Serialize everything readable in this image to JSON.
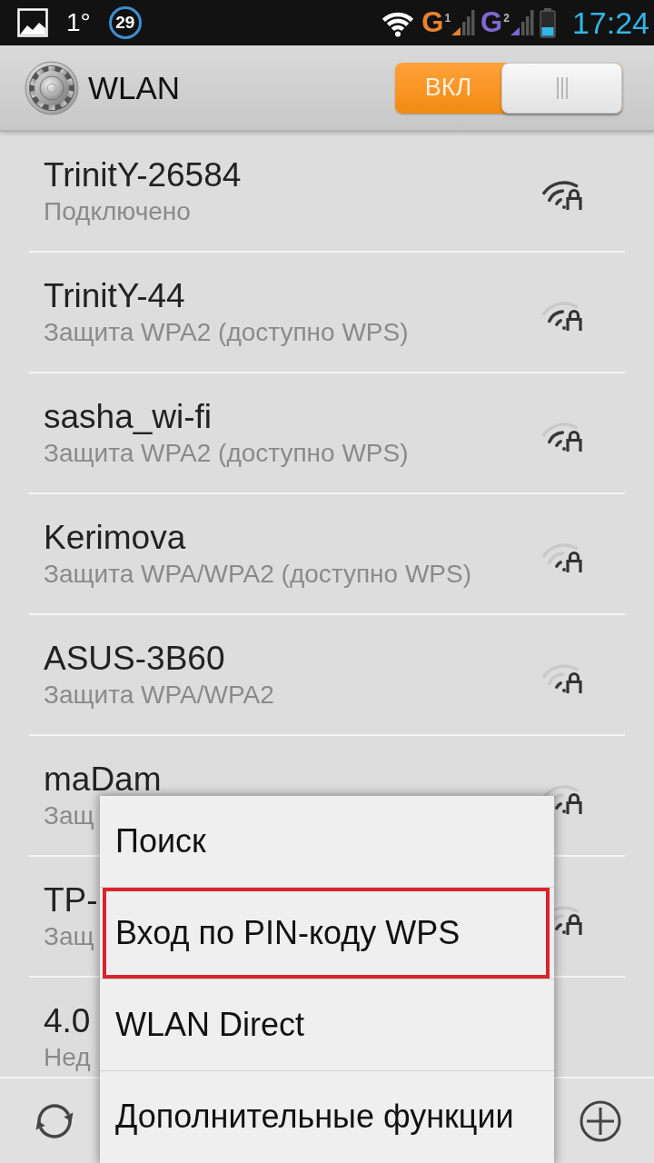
{
  "status_bar": {
    "temperature": "1°",
    "badge": "29",
    "sims": [
      {
        "network": "G",
        "slot": "1",
        "color": "#e8822c"
      },
      {
        "network": "G",
        "slot": "2",
        "color": "#7e68d0"
      }
    ],
    "time": "17:24"
  },
  "header": {
    "title": "WLAN",
    "switch": {
      "label": "ВКЛ",
      "on": true
    }
  },
  "networks": [
    {
      "name": "TrinitY-26584",
      "status": "Подключено",
      "kind": "strong"
    },
    {
      "name": "TrinitY-44",
      "status": "Защита WPA2 (доступно WPS)",
      "kind": "fair"
    },
    {
      "name": "sasha_wi-fi",
      "status": "Защита WPA2 (доступно WPS)",
      "kind": "fair"
    },
    {
      "name": "Kerimova",
      "status": "Защита WPA/WPA2 (доступно WPS)",
      "kind": "weak"
    },
    {
      "name": "ASUS-3B60",
      "status": "Защита WPA/WPA2",
      "kind": "weak"
    },
    {
      "name": "maDam",
      "status": "Защ",
      "kind": "weak"
    },
    {
      "name": "TP-",
      "status": "Защ",
      "kind": "weak"
    },
    {
      "name": "4.0",
      "status": "Нед",
      "kind": "unreachable"
    }
  ],
  "menu": {
    "items": [
      {
        "label": "Поиск",
        "highlighted": false
      },
      {
        "label": "Вход по PIN-коду WPS",
        "highlighted": true
      },
      {
        "label": "WLAN Direct",
        "highlighted": false
      },
      {
        "label": "Дополнительные функции",
        "highlighted": false
      }
    ]
  }
}
